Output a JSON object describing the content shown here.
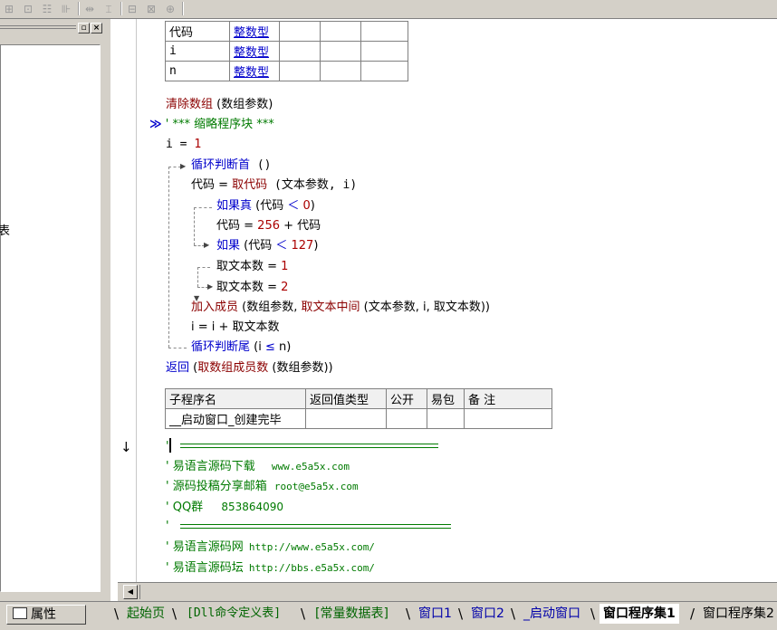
{
  "toolbar": {
    "buttons": [
      "align-left",
      "align-center",
      "align-top",
      "align-middle",
      "same-width",
      "same-height",
      "h-spacing",
      "v-spacing",
      "center-form"
    ]
  },
  "left_panel": {
    "partial_text": "表"
  },
  "var_table": {
    "rows": [
      {
        "name": "代码",
        "type": "整数型"
      },
      {
        "name": "i",
        "type": "整数型"
      },
      {
        "name": "n",
        "type": "整数型"
      }
    ]
  },
  "code": {
    "l1_cmd": "清除数组",
    "l1_args": " (数组参数)",
    "l2_marker": "≫",
    "l2_text": "' *** 缩略程序块 ***",
    "l3_a": "i = ",
    "l3_b": "1",
    "l4_cmd": "循环判断首",
    "l4_rest": " ()",
    "l5_a": "代码 = ",
    "l5_cmd": "取代码",
    "l5_rest": " (文本参数, i)",
    "l6_cmd": "如果真",
    "l6_a": " (代码 ",
    "l6_op": "＜",
    "l6_b": " 0",
    "l6_c": ")",
    "l7_a": "代码 = ",
    "l7_b": "256",
    "l7_c": " + 代码",
    "l8_cmd": "如果",
    "l8_a": " (代码 ",
    "l8_op": "＜",
    "l8_b": " 127",
    "l8_c": ")",
    "l9_a": "取文本数 = ",
    "l9_b": "1",
    "l10_a": "取文本数 = ",
    "l10_b": "2",
    "l11_cmd": "加入成员",
    "l11_a": " (数组参数, ",
    "l11_cmd2": "取文本中间",
    "l11_b": " (文本参数, i, 取文本数))",
    "l12_text": "i = i + 取文本数",
    "l13_cmd": "循环判断尾",
    "l13_a": " (i ",
    "l13_op": "≤",
    "l13_b": " n)",
    "l14_cmd": "返回",
    "l14_a": " (",
    "l14_cmd2": "取数组成员数",
    "l14_b": " (数组参数))"
  },
  "sub_table": {
    "headers": [
      "子程序名",
      "返回值类型",
      "公开",
      "易包",
      "备 注"
    ],
    "name": "__启动窗口_创建完毕"
  },
  "comments": {
    "c1": "'",
    "c2": "' 易语言源码下载",
    "c2_url": "www.e5a5x.com",
    "c3": "' 源码投稿分享邮箱",
    "c3_mail": "root@e5a5x.com",
    "c4": "' QQ群",
    "c4_num": "853864090",
    "c5": "'",
    "c6": "' 易语言源码网",
    "c6_url": "http://www.e5a5x.com/",
    "c7": "' 易语言源码坛",
    "c7_url": "http://bbs.e5a5x.com/",
    "cursor_arrow": "↓"
  },
  "bottom": {
    "props_label": "属性",
    "tabs": [
      "起始页",
      "[Dll命令定义表]",
      "[常量数据表]",
      "窗口1",
      "窗口2",
      "_启动窗口",
      "窗口程序集1",
      "窗口程序集2"
    ]
  },
  "colors": {
    "keyword": "#8b0000",
    "blue_keyword": "#0000cc",
    "number": "#aa0000",
    "comment": "#007a00",
    "chrome": "#d4d0c8"
  }
}
